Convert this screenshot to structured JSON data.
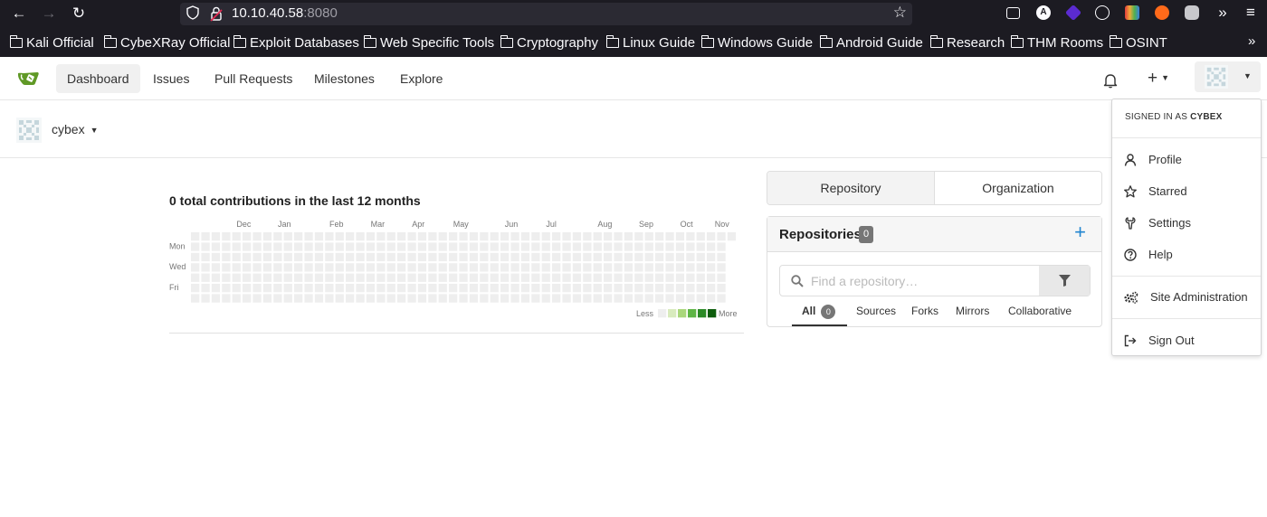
{
  "browser": {
    "url_host": "10.10.40.58",
    "url_port": ":8080",
    "bookmarks": [
      "Kali Official",
      "CybeXRay Official",
      "Exploit Databases",
      "Web Specific Tools",
      "Cryptography",
      "Linux Guide",
      "Windows Guide",
      "Android Guide",
      "Research",
      "THM Rooms",
      "OSINT"
    ]
  },
  "navbar": {
    "items": [
      "Dashboard",
      "Issues",
      "Pull Requests",
      "Milestones",
      "Explore"
    ],
    "active": "Dashboard",
    "add_label": "+"
  },
  "context": {
    "username": "cybex"
  },
  "heatmap": {
    "title": "0 total contributions in the last 12 months",
    "months": [
      "Dec",
      "Jan",
      "Feb",
      "Mar",
      "Apr",
      "May",
      "Jun",
      "Jul",
      "Aug",
      "Sep",
      "Oct",
      "Nov"
    ],
    "days": [
      "Mon",
      "Wed",
      "Fri"
    ],
    "less_label": "Less",
    "more_label": "More",
    "empty_color": "#eeeeee",
    "scale_colors": [
      "#eeeeee",
      "#d8ebbd",
      "#a9d77b",
      "#5eb545",
      "#2b8a25",
      "#0d5d0c"
    ]
  },
  "repo_tabs": [
    "Repository",
    "Organization"
  ],
  "repositories": {
    "title": "Repositories",
    "count": "0",
    "search_placeholder": "Find a repository…",
    "filters": [
      "All",
      "Sources",
      "Forks",
      "Mirrors",
      "Collaborative"
    ],
    "all_count": "0"
  },
  "user_menu": {
    "signed_in_prefix": "SIGNED IN AS ",
    "signed_in_user": "CYBEX",
    "items": [
      "Profile",
      "Starred",
      "Settings",
      "Help",
      "Site Administration",
      "Sign Out"
    ]
  },
  "colors": {
    "accent": "#2185d0",
    "browser_bg": "#1c1b22",
    "gitea_green": "#609926"
  }
}
